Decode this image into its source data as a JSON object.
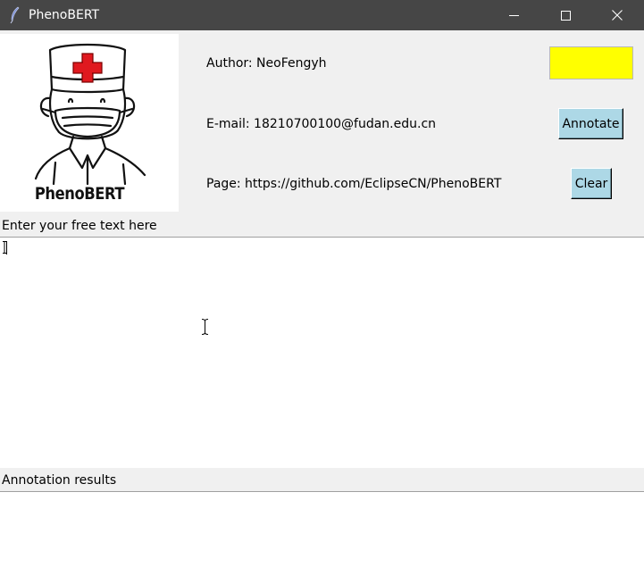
{
  "window": {
    "title": "PhenoBERT",
    "icon": "feather-icon",
    "controls": [
      "minimize-icon",
      "maximize-icon",
      "close-icon"
    ]
  },
  "logo": {
    "text": "PhenoBERT",
    "icon": "doctor-with-mask-illustration"
  },
  "info": {
    "author": "Author: NeoFengyh",
    "email": "E-mail: 18210700100@fudan.edu.cn",
    "page": "Page: https://github.com/EclipseCN/PhenoBERT"
  },
  "color_swatch": {
    "color": "#ffff00"
  },
  "buttons": {
    "annotate": "Annotate",
    "clear": "Clear",
    "color": "#add8e6"
  },
  "input_section": {
    "label": "Enter your free text here",
    "value": ""
  },
  "results_section": {
    "label": "Annotation results",
    "value": ""
  }
}
